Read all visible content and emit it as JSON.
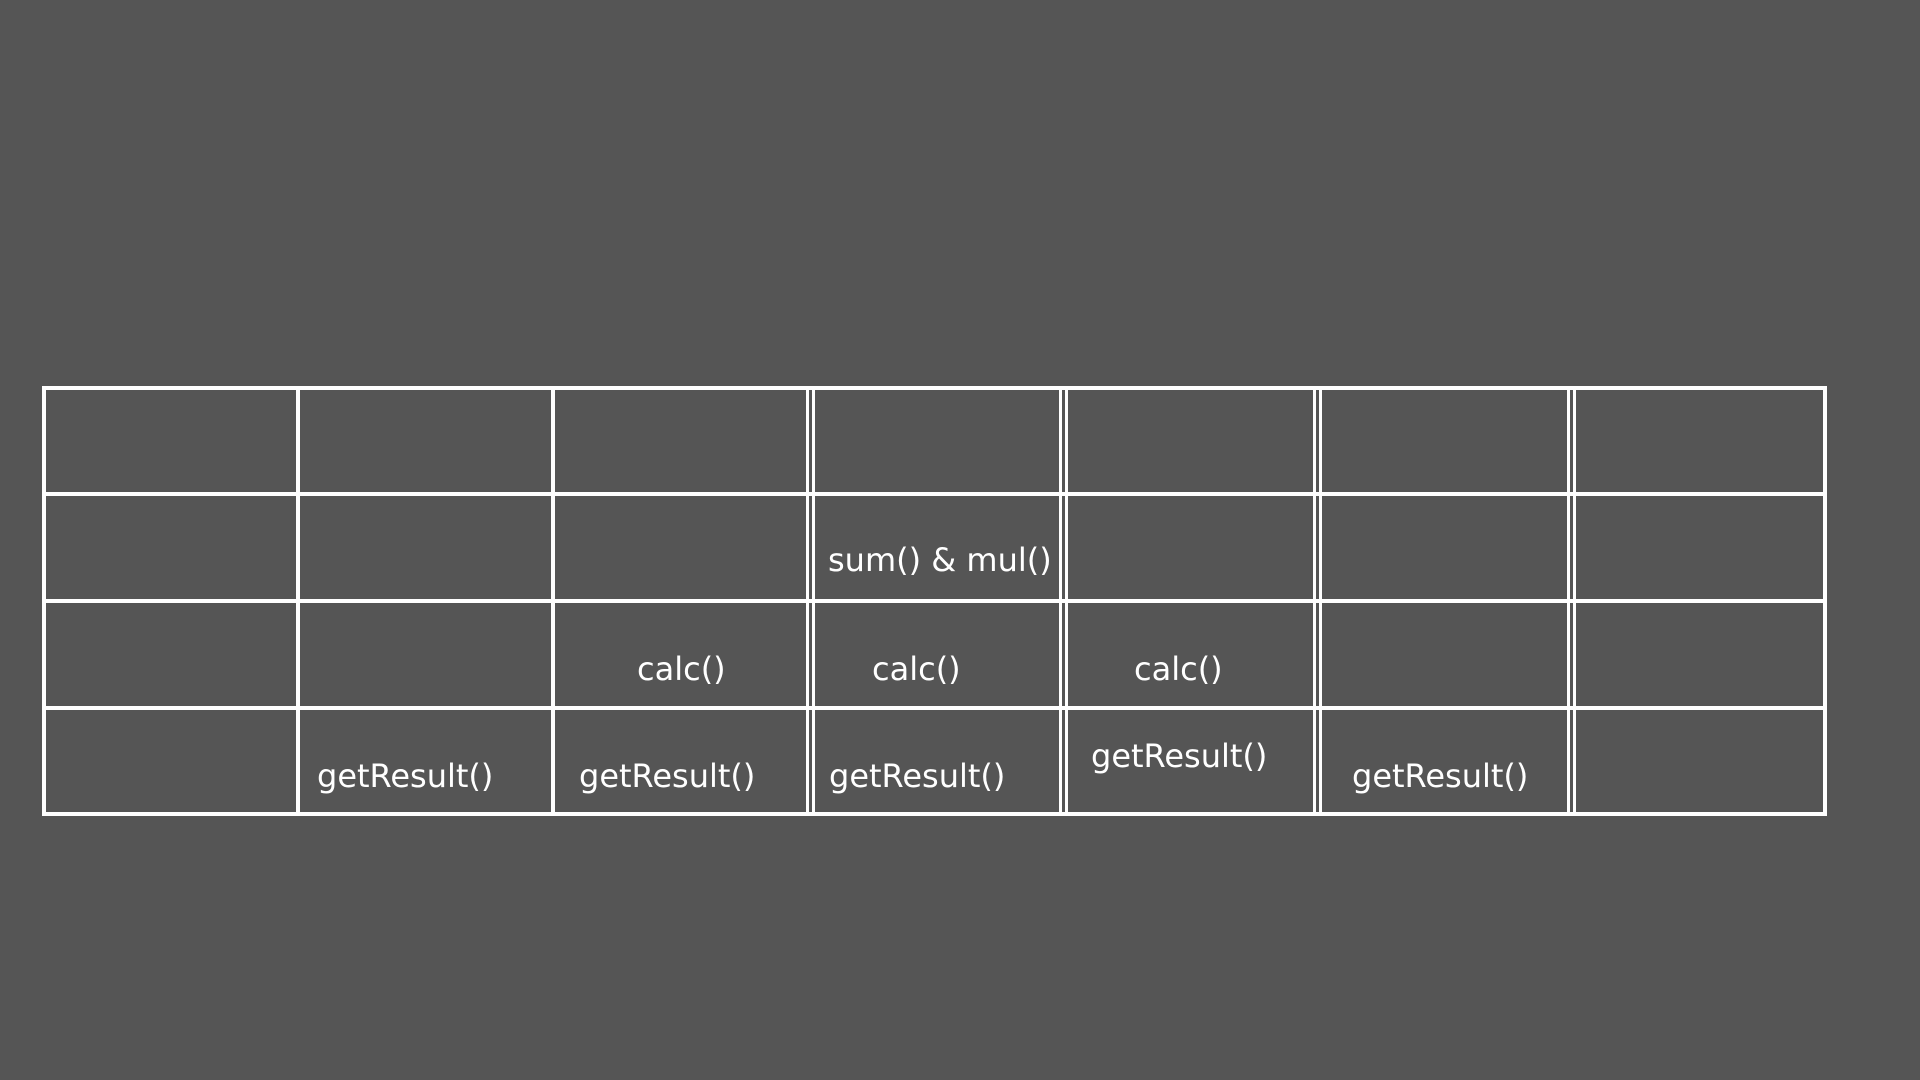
{
  "colors": {
    "background": "#555555",
    "grid_line": "#ffffff",
    "text": "#ffffff"
  },
  "grid": {
    "columns": 7,
    "rows": 4,
    "cells": [
      [
        "",
        "",
        "",
        "",
        "",
        "",
        ""
      ],
      [
        "",
        "",
        "",
        "sum() & mul()",
        "",
        "",
        ""
      ],
      [
        "",
        "",
        "calc()",
        "calc()",
        "calc()",
        "",
        ""
      ],
      [
        "",
        "getResult()",
        "getResult()",
        "getResult()",
        "getResult()",
        "getResult()",
        ""
      ]
    ]
  }
}
